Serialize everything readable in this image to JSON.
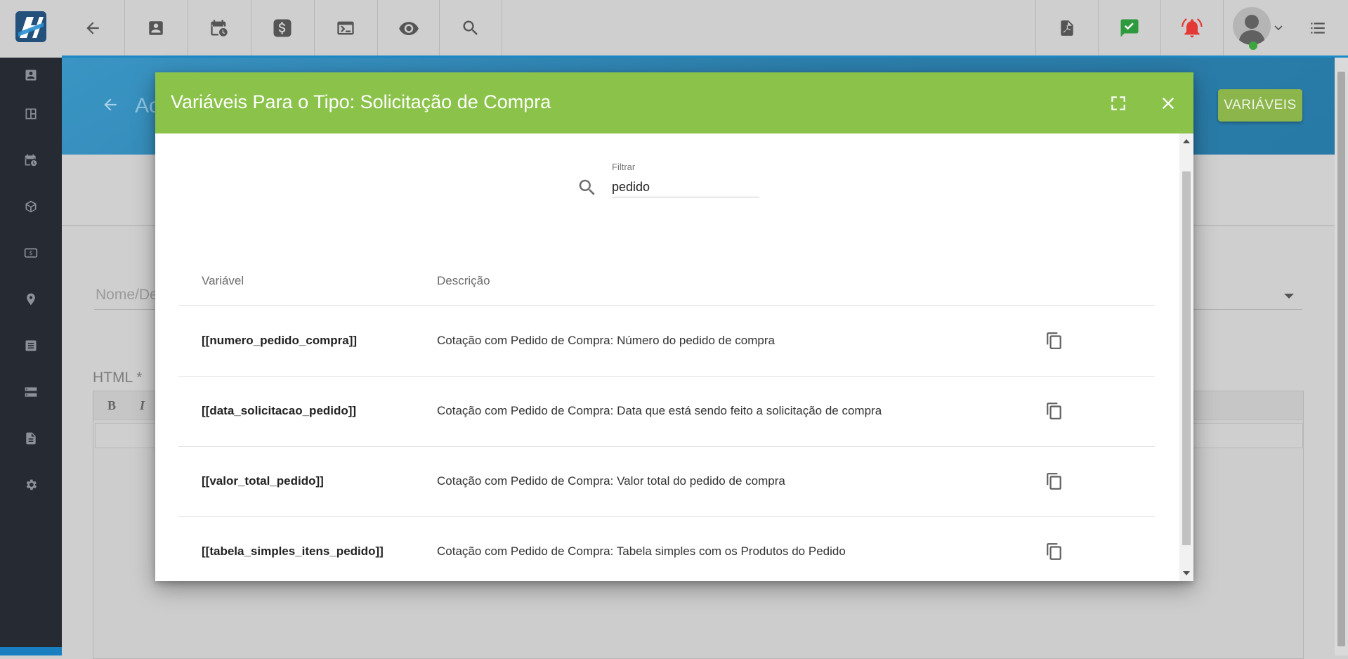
{
  "topbar": {
    "logo_name": "app-logo",
    "buttons": [
      {
        "icon": "back-arrow-icon"
      },
      {
        "icon": "contact-card-icon"
      },
      {
        "icon": "calendar-clock-icon"
      },
      {
        "icon": "dollar-icon"
      },
      {
        "icon": "terminal-icon"
      },
      {
        "icon": "eye-icon"
      },
      {
        "icon": "search-icon"
      }
    ],
    "right_buttons": [
      {
        "icon": "pdf-icon"
      },
      {
        "icon": "chat-check-icon",
        "color": "#2e9a3e"
      },
      {
        "icon": "bell-alert-icon",
        "color": "#e53935"
      },
      {
        "icon": "user-avatar-icon"
      },
      {
        "icon": "list-menu-icon"
      }
    ],
    "accent_color": "#1c88c6"
  },
  "sidebar": {
    "items": [
      {
        "icon": "contact-icon"
      },
      {
        "icon": "dashboard-icon"
      },
      {
        "icon": "calendar-clock-icon"
      },
      {
        "icon": "box-icon"
      },
      {
        "icon": "money-icon"
      },
      {
        "icon": "location-icon"
      },
      {
        "icon": "list-box-icon"
      },
      {
        "icon": "server-icon"
      },
      {
        "icon": "document-icon"
      },
      {
        "icon": "gear-icon"
      }
    ],
    "background": "#262b33"
  },
  "page": {
    "title_partial": "Ac",
    "variables_button": "VARIÁVEIS",
    "name_field_label": "Nome/De",
    "html_label": "HTML *",
    "editor_bold": "B",
    "editor_italic": "I"
  },
  "modal": {
    "title": "Variáveis Para o Tipo: Solicitação de Compra",
    "header_color": "#8bc34a",
    "filter": {
      "label": "Filtrar",
      "value": "pedido"
    },
    "columns": {
      "variable": "Variável",
      "description": "Descrição"
    },
    "rows": [
      {
        "variable": "[[numero_pedido_compra]]",
        "description": "Cotação com Pedido de Compra: Número do pedido de compra"
      },
      {
        "variable": "[[data_solicitacao_pedido]]",
        "description": "Cotação com Pedido de Compra: Data que está sendo feito a solicitação de compra"
      },
      {
        "variable": "[[valor_total_pedido]]",
        "description": "Cotação com Pedido de Compra: Valor total do pedido de compra"
      },
      {
        "variable": "[[tabela_simples_itens_pedido]]",
        "description": "Cotação com Pedido de Compra: Tabela simples com os Produtos do Pedido"
      }
    ]
  }
}
